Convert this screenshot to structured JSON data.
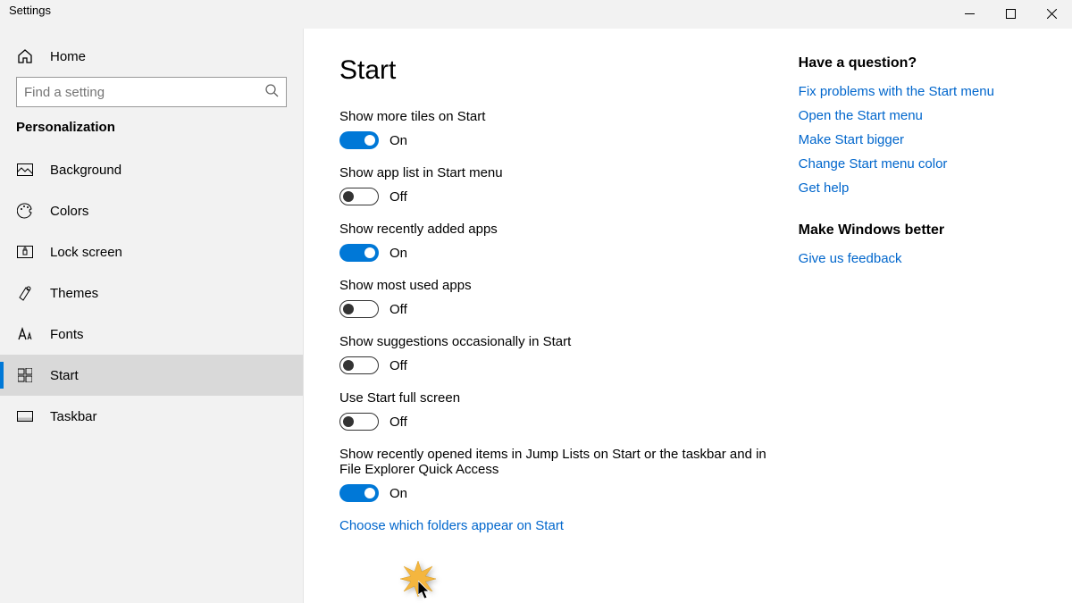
{
  "window": {
    "title": "Settings"
  },
  "sidebar": {
    "home": "Home",
    "search_placeholder": "Find a setting",
    "category": "Personalization",
    "items": [
      {
        "label": "Background"
      },
      {
        "label": "Colors"
      },
      {
        "label": "Lock screen"
      },
      {
        "label": "Themes"
      },
      {
        "label": "Fonts"
      },
      {
        "label": "Start"
      },
      {
        "label": "Taskbar"
      }
    ]
  },
  "page": {
    "title": "Start",
    "on_label": "On",
    "off_label": "Off",
    "settings": [
      {
        "label": "Show more tiles on Start",
        "on": true
      },
      {
        "label": "Show app list in Start menu",
        "on": false
      },
      {
        "label": "Show recently added apps",
        "on": true
      },
      {
        "label": "Show most used apps",
        "on": false
      },
      {
        "label": "Show suggestions occasionally in Start",
        "on": false
      },
      {
        "label": "Use Start full screen",
        "on": false
      },
      {
        "label": "Show recently opened items in Jump Lists on Start or the taskbar and in File Explorer Quick Access",
        "on": true
      }
    ],
    "link": "Choose which folders appear on Start"
  },
  "help": {
    "q_heading": "Have a question?",
    "links": [
      "Fix problems with the Start menu",
      "Open the Start menu",
      "Make Start bigger",
      "Change Start menu color",
      "Get help"
    ],
    "better_heading": "Make Windows better",
    "feedback": "Give us feedback"
  }
}
